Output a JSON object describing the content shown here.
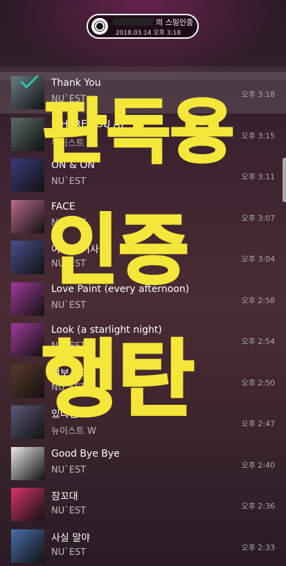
{
  "header": {
    "title_suffix": "의 스밍인증",
    "date": "2018.03.14 오후 3:18"
  },
  "songs": [
    {
      "title": "Thank You",
      "artist": "NU`EST",
      "time": "오후 3:18",
      "art": "#6a7c86"
    },
    {
      "title": "WHERE YOU AT",
      "artist": "뉴이스트 W",
      "time": "오후 3:15",
      "art": "#5b6d63"
    },
    {
      "title": "ON & ON",
      "artist": "NU`EST",
      "time": "오후 3:11",
      "art": "#3a3c7a"
    },
    {
      "title": "FACE",
      "artist": "NU`EST",
      "time": "오후 3:07",
      "art": "#b86a8c"
    },
    {
      "title": "여왕의 기사",
      "artist": "NU`EST",
      "time": "오후 3:04",
      "art": "#4a4f8c"
    },
    {
      "title": "Love Paint (every afternoon)",
      "artist": "NU`EST",
      "time": "오후 2:58",
      "art": "#a03a9a"
    },
    {
      "title": "Look (a starlight night)",
      "artist": "NU`EST",
      "time": "오후 2:54",
      "art": "#a03a9a"
    },
    {
      "title": "여보세요",
      "artist": "NU`EST",
      "time": "오후 2:50",
      "art": "#5a3a2a"
    },
    {
      "title": "있다면",
      "artist": "뉴이스트 W",
      "time": "오후 2:47",
      "art": "#5a5a7a"
    },
    {
      "title": "Good Bye Bye",
      "artist": "NU`EST",
      "time": "오후 2:40",
      "art": "#e9e9e9"
    },
    {
      "title": "잠꼬대",
      "artist": "NU`EST",
      "time": "오후 2:36",
      "art": "#d8336a"
    },
    {
      "title": "사실 말야",
      "artist": "NU`EST",
      "time": "오후 2:33",
      "art": "#4a6fa8"
    }
  ],
  "overlay": {
    "line1": "판독용",
    "line2": "인증",
    "line3": "행탄"
  }
}
